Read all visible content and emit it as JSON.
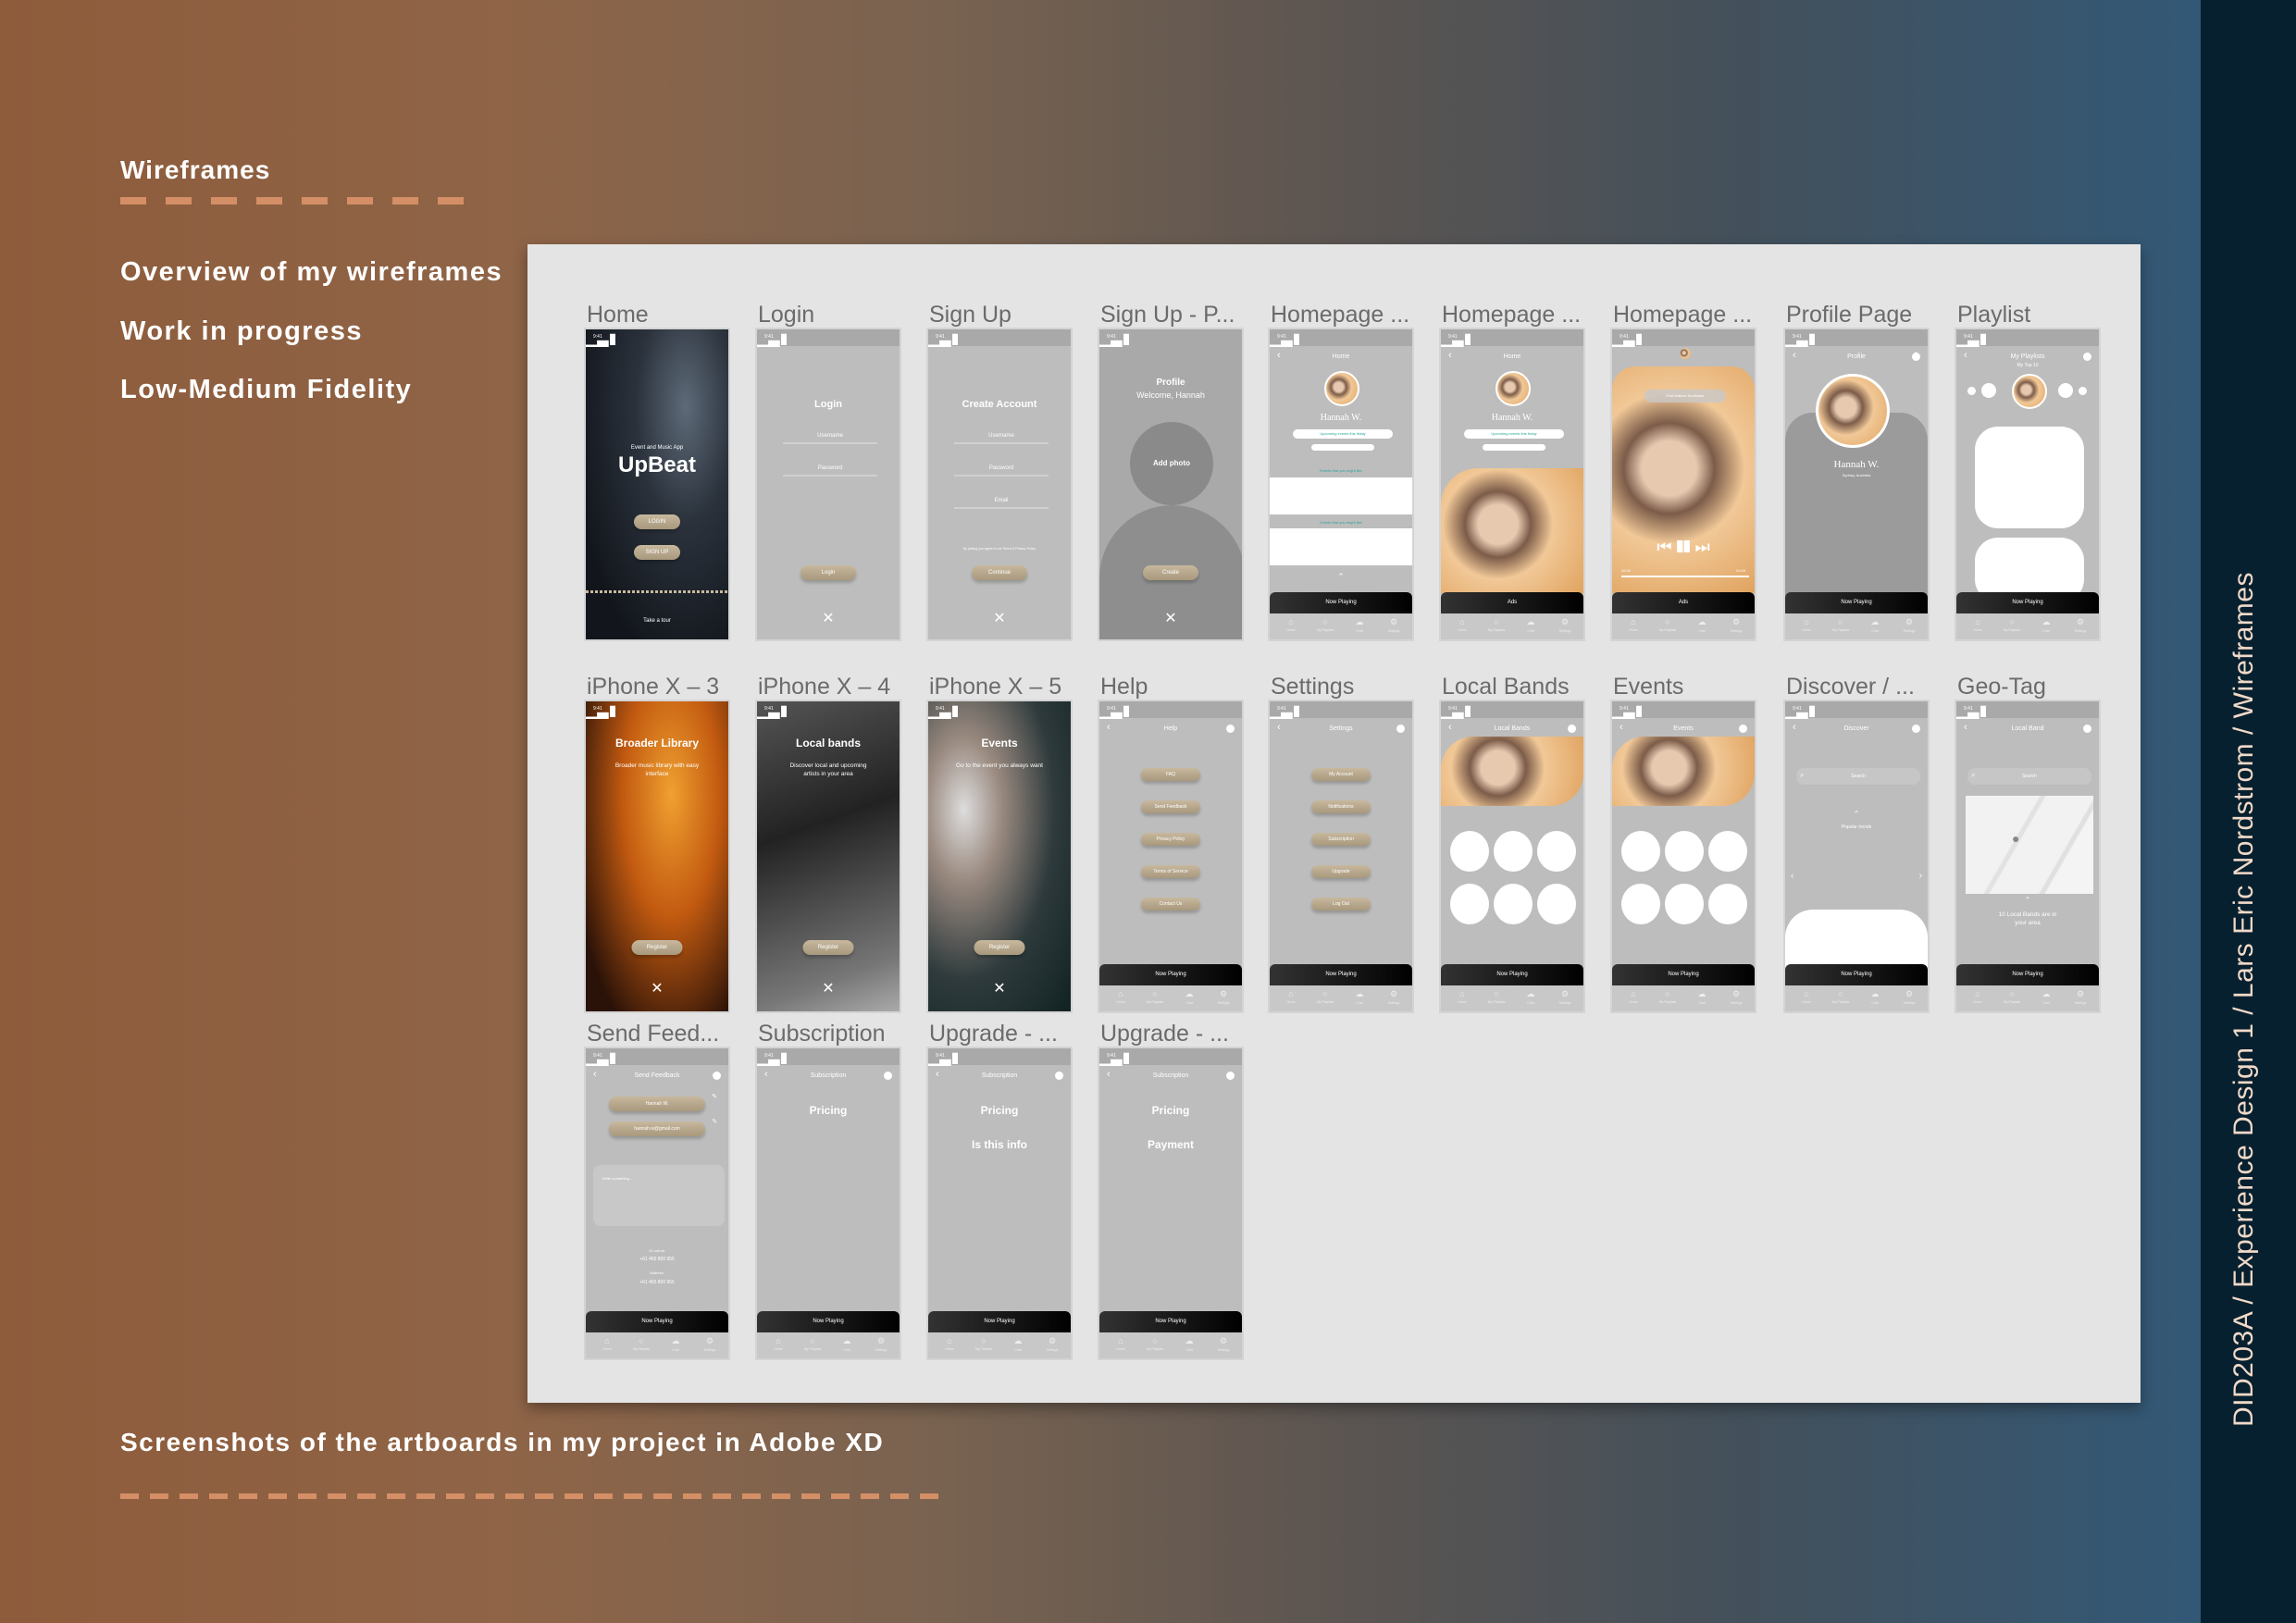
{
  "sidebar": {
    "title": "Wireframes",
    "items": [
      "Overview of my wireframes",
      "Work in progress",
      "Low-Medium Fidelity"
    ]
  },
  "caption": "Screenshots of the artboards in my project in Adobe XD",
  "vertical_label": "DID203A  /  Experience Design 1  /  Lars Eric Nordstrom  /  Wireframes",
  "colors": {
    "accent_dash": "#d48f66",
    "button": "#b5a58b",
    "panel": "#e4e4e4",
    "rightbar": "#06202f"
  },
  "phone_common": {
    "time": "9:41",
    "tabs": [
      "Home",
      "My Playlists",
      "Chat",
      "Settings"
    ]
  },
  "artboards": [
    {
      "title": "Home",
      "kind": "splash",
      "small": "Event and Music App",
      "heading": "UpBeat",
      "buttons": [
        "LOGIN",
        "SIGN UP"
      ],
      "footer": "Take a tour"
    },
    {
      "title": "Login",
      "kind": "form",
      "heading": "Login",
      "fields": [
        "Username",
        "Password"
      ],
      "button": "Login"
    },
    {
      "title": "Sign Up",
      "kind": "form",
      "heading": "Create Account",
      "fields": [
        "Username",
        "Password",
        "Email"
      ],
      "note": "By joining you agree to our Terms & Privacy Policy",
      "button": "Continue"
    },
    {
      "title": "Sign Up - P...",
      "kind": "photo-signup",
      "heading": "Profile",
      "sub": "Welcome, Hannah",
      "circle": "Add photo",
      "button": "Create"
    },
    {
      "title": "Homepage ...",
      "kind": "home",
      "header": "Home",
      "name": "Hannah W.",
      "pill": "Upcoming events this friday",
      "section": "Events that you might like",
      "now": "Now Playing"
    },
    {
      "title": "Homepage ...",
      "kind": "home-photo",
      "header": "Home",
      "name": "Hannah W.",
      "pill": "Upcoming events this friday",
      "now": "Ads"
    },
    {
      "title": "Homepage ...",
      "kind": "player",
      "song": "Post Malone Sunflower",
      "t0": "00:00",
      "t1": "03:25",
      "now": "Ads"
    },
    {
      "title": "Profile Page",
      "kind": "profile",
      "header": "Profile",
      "name": "Hannah W.",
      "loc": "Sydney, Australia",
      "now": "Now Playing"
    },
    {
      "title": "Playlist",
      "kind": "playlist",
      "header": "My Playlists",
      "sub": "My Top 10",
      "now": "Now Playing"
    },
    {
      "title": "iPhone X – 3",
      "kind": "onboard",
      "theme": "orange",
      "heading": "Broader Library",
      "sub": "Broader music library with easy interface",
      "button": "Register"
    },
    {
      "title": "iPhone X – 4",
      "kind": "onboard",
      "theme": "mono",
      "heading": "Local bands",
      "sub": "Discover local and upcoming artists in your area",
      "button": "Register"
    },
    {
      "title": "iPhone X – 5",
      "kind": "onboard",
      "theme": "teal",
      "heading": "Events",
      "sub": "Go to the event you always want",
      "button": "Register"
    },
    {
      "title": "Help",
      "kind": "menu",
      "header": "Help",
      "items": [
        "FAQ",
        "Send Feedback",
        "Privacy Policy",
        "Terms of Service",
        "Contact Us"
      ],
      "now": "Now Playing"
    },
    {
      "title": "Settings",
      "kind": "menu",
      "header": "Settings",
      "items": [
        "My Account",
        "Notifications",
        "Subscription",
        "Upgrade",
        "Log Out"
      ],
      "now": "Now Playing"
    },
    {
      "title": "Local Bands",
      "kind": "grid",
      "header": "Local Bands",
      "now": "Now Playing"
    },
    {
      "title": "Events",
      "kind": "grid",
      "header": "Events",
      "now": "Now Playing"
    },
    {
      "title": "Discover / ...",
      "kind": "discover",
      "header": "Discover",
      "search": "Search",
      "trend": "Popular trends",
      "now": "Now Playing"
    },
    {
      "title": "Geo-Tag",
      "kind": "geo",
      "header": "Local Band",
      "search": "Search",
      "info": "10 Local Bands are in your area",
      "now": "Now Playing"
    },
    {
      "title": "Send Feed...",
      "kind": "feedback",
      "header": "Send Feedback",
      "fields": [
        "Hannah W.",
        "hannah.w@gmail.com"
      ],
      "placeholder": "Write something...",
      "call": "Or call us:",
      "phone": "+61 465 800 955",
      "addr": "Address:",
      "addr_val": "+61 465 800 955",
      "now": "Now Playing"
    },
    {
      "title": "Subscription",
      "kind": "sub",
      "header": "Subscription",
      "lines": [
        "Pricing"
      ],
      "now": "Now Playing"
    },
    {
      "title": "Upgrade - ...",
      "kind": "sub",
      "header": "Subscription",
      "lines": [
        "Pricing",
        "Is this info"
      ],
      "now": "Now Playing"
    },
    {
      "title": "Upgrade - ...",
      "kind": "sub",
      "header": "Subscription",
      "lines": [
        "Pricing",
        "Payment"
      ],
      "now": "Now Playing"
    }
  ]
}
